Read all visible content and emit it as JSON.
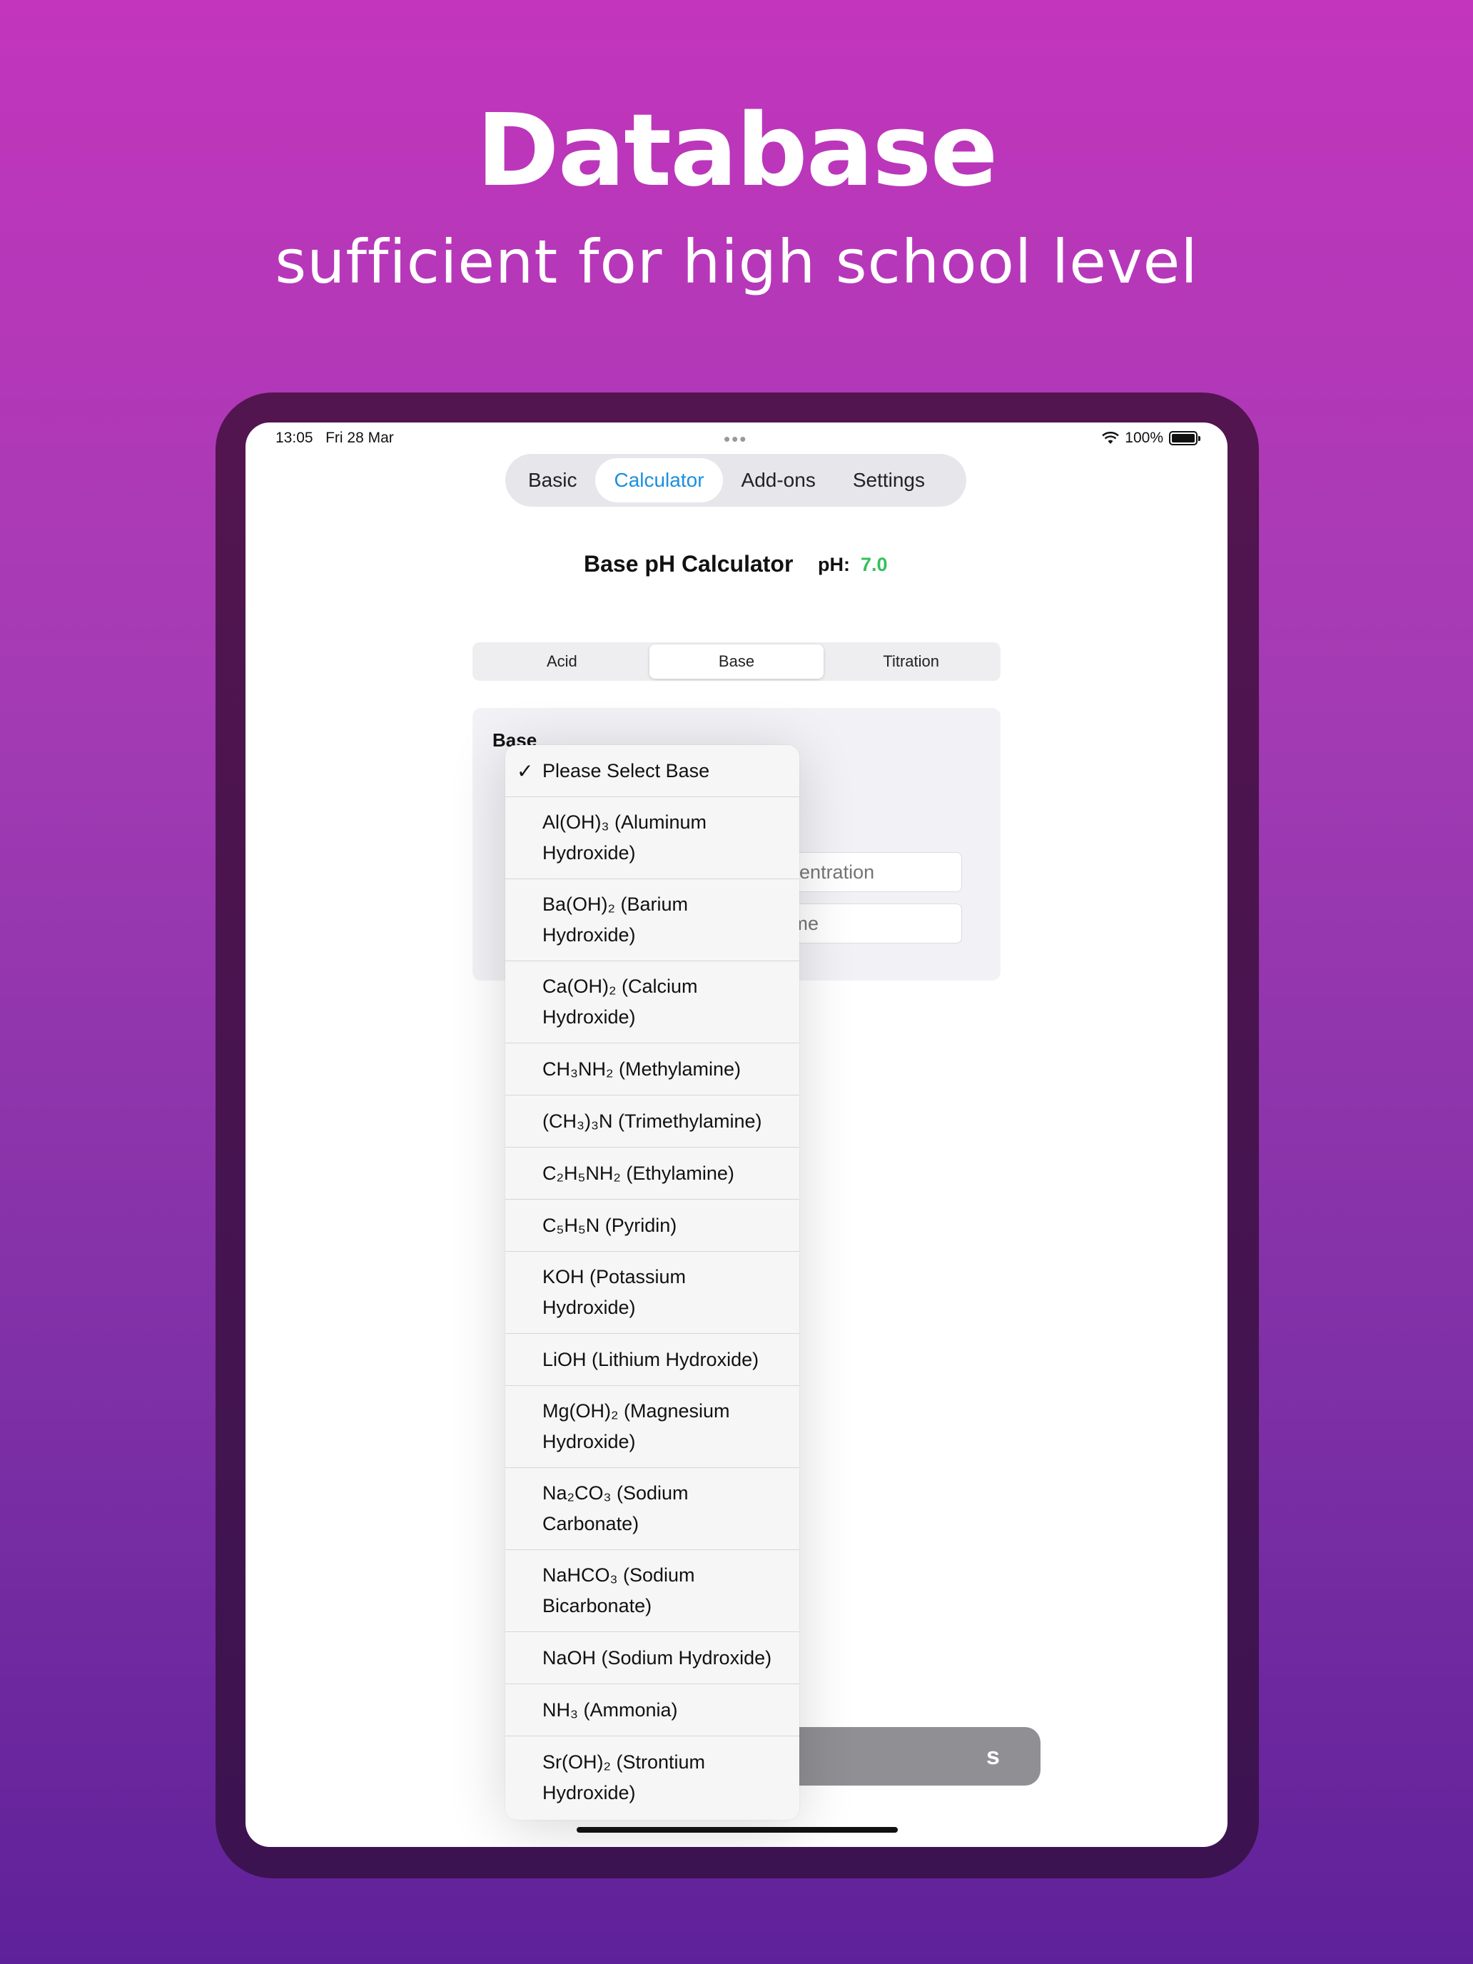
{
  "marketing": {
    "headline": "Database",
    "subline": "sufficient for high school level"
  },
  "status_bar": {
    "time": "13:05",
    "date": "Fri 28 Mar",
    "battery": "100%"
  },
  "tabs": [
    {
      "label": "Basic"
    },
    {
      "label": "Calculator",
      "active": true
    },
    {
      "label": "Add-ons"
    },
    {
      "label": "Settings"
    }
  ],
  "calculator": {
    "title": "Base pH Calculator",
    "ph_label": "pH:",
    "ph_value": "7.0"
  },
  "segments": [
    {
      "label": "Acid"
    },
    {
      "label": "Base",
      "active": true
    },
    {
      "label": "Titration"
    }
  ],
  "panel": {
    "label": "Base",
    "concentration_placeholder": "Concentration",
    "volume_placeholder": "Volume"
  },
  "calculate_button": {
    "visible_text": "s"
  },
  "dropdown": {
    "selected": "Please Select Base",
    "options": [
      {
        "label": "Please Select Base",
        "selected": true
      },
      {
        "label": "Al(OH)₃ (Aluminum Hydroxide)"
      },
      {
        "label": "Ba(OH)₂ (Barium Hydroxide)"
      },
      {
        "label": "Ca(OH)₂ (Calcium Hydroxide)"
      },
      {
        "label": "CH₃NH₂ (Methylamine)"
      },
      {
        "label": "(CH₃)₃N (Trimethylamine)"
      },
      {
        "label": "C₂H₅NH₂ (Ethylamine)"
      },
      {
        "label": "C₅H₅N (Pyridin)"
      },
      {
        "label": "KOH (Potassium Hydroxide)"
      },
      {
        "label": "LiOH (Lithium Hydroxide)"
      },
      {
        "label": "Mg(OH)₂ (Magnesium Hydroxide)"
      },
      {
        "label": "Na₂CO₃ (Sodium Carbonate)"
      },
      {
        "label": "NaHCO₃ (Sodium Bicarbonate)"
      },
      {
        "label": "NaOH (Sodium Hydroxide)"
      },
      {
        "label": "NH₃ (Ammonia)"
      },
      {
        "label": "Sr(OH)₂ (Strontium Hydroxide)"
      }
    ]
  },
  "colors": {
    "accent_blue": "#1a8fe0",
    "ph_green": "#33c15a",
    "background_top": "#c235bc",
    "background_bottom": "#5f2199"
  }
}
